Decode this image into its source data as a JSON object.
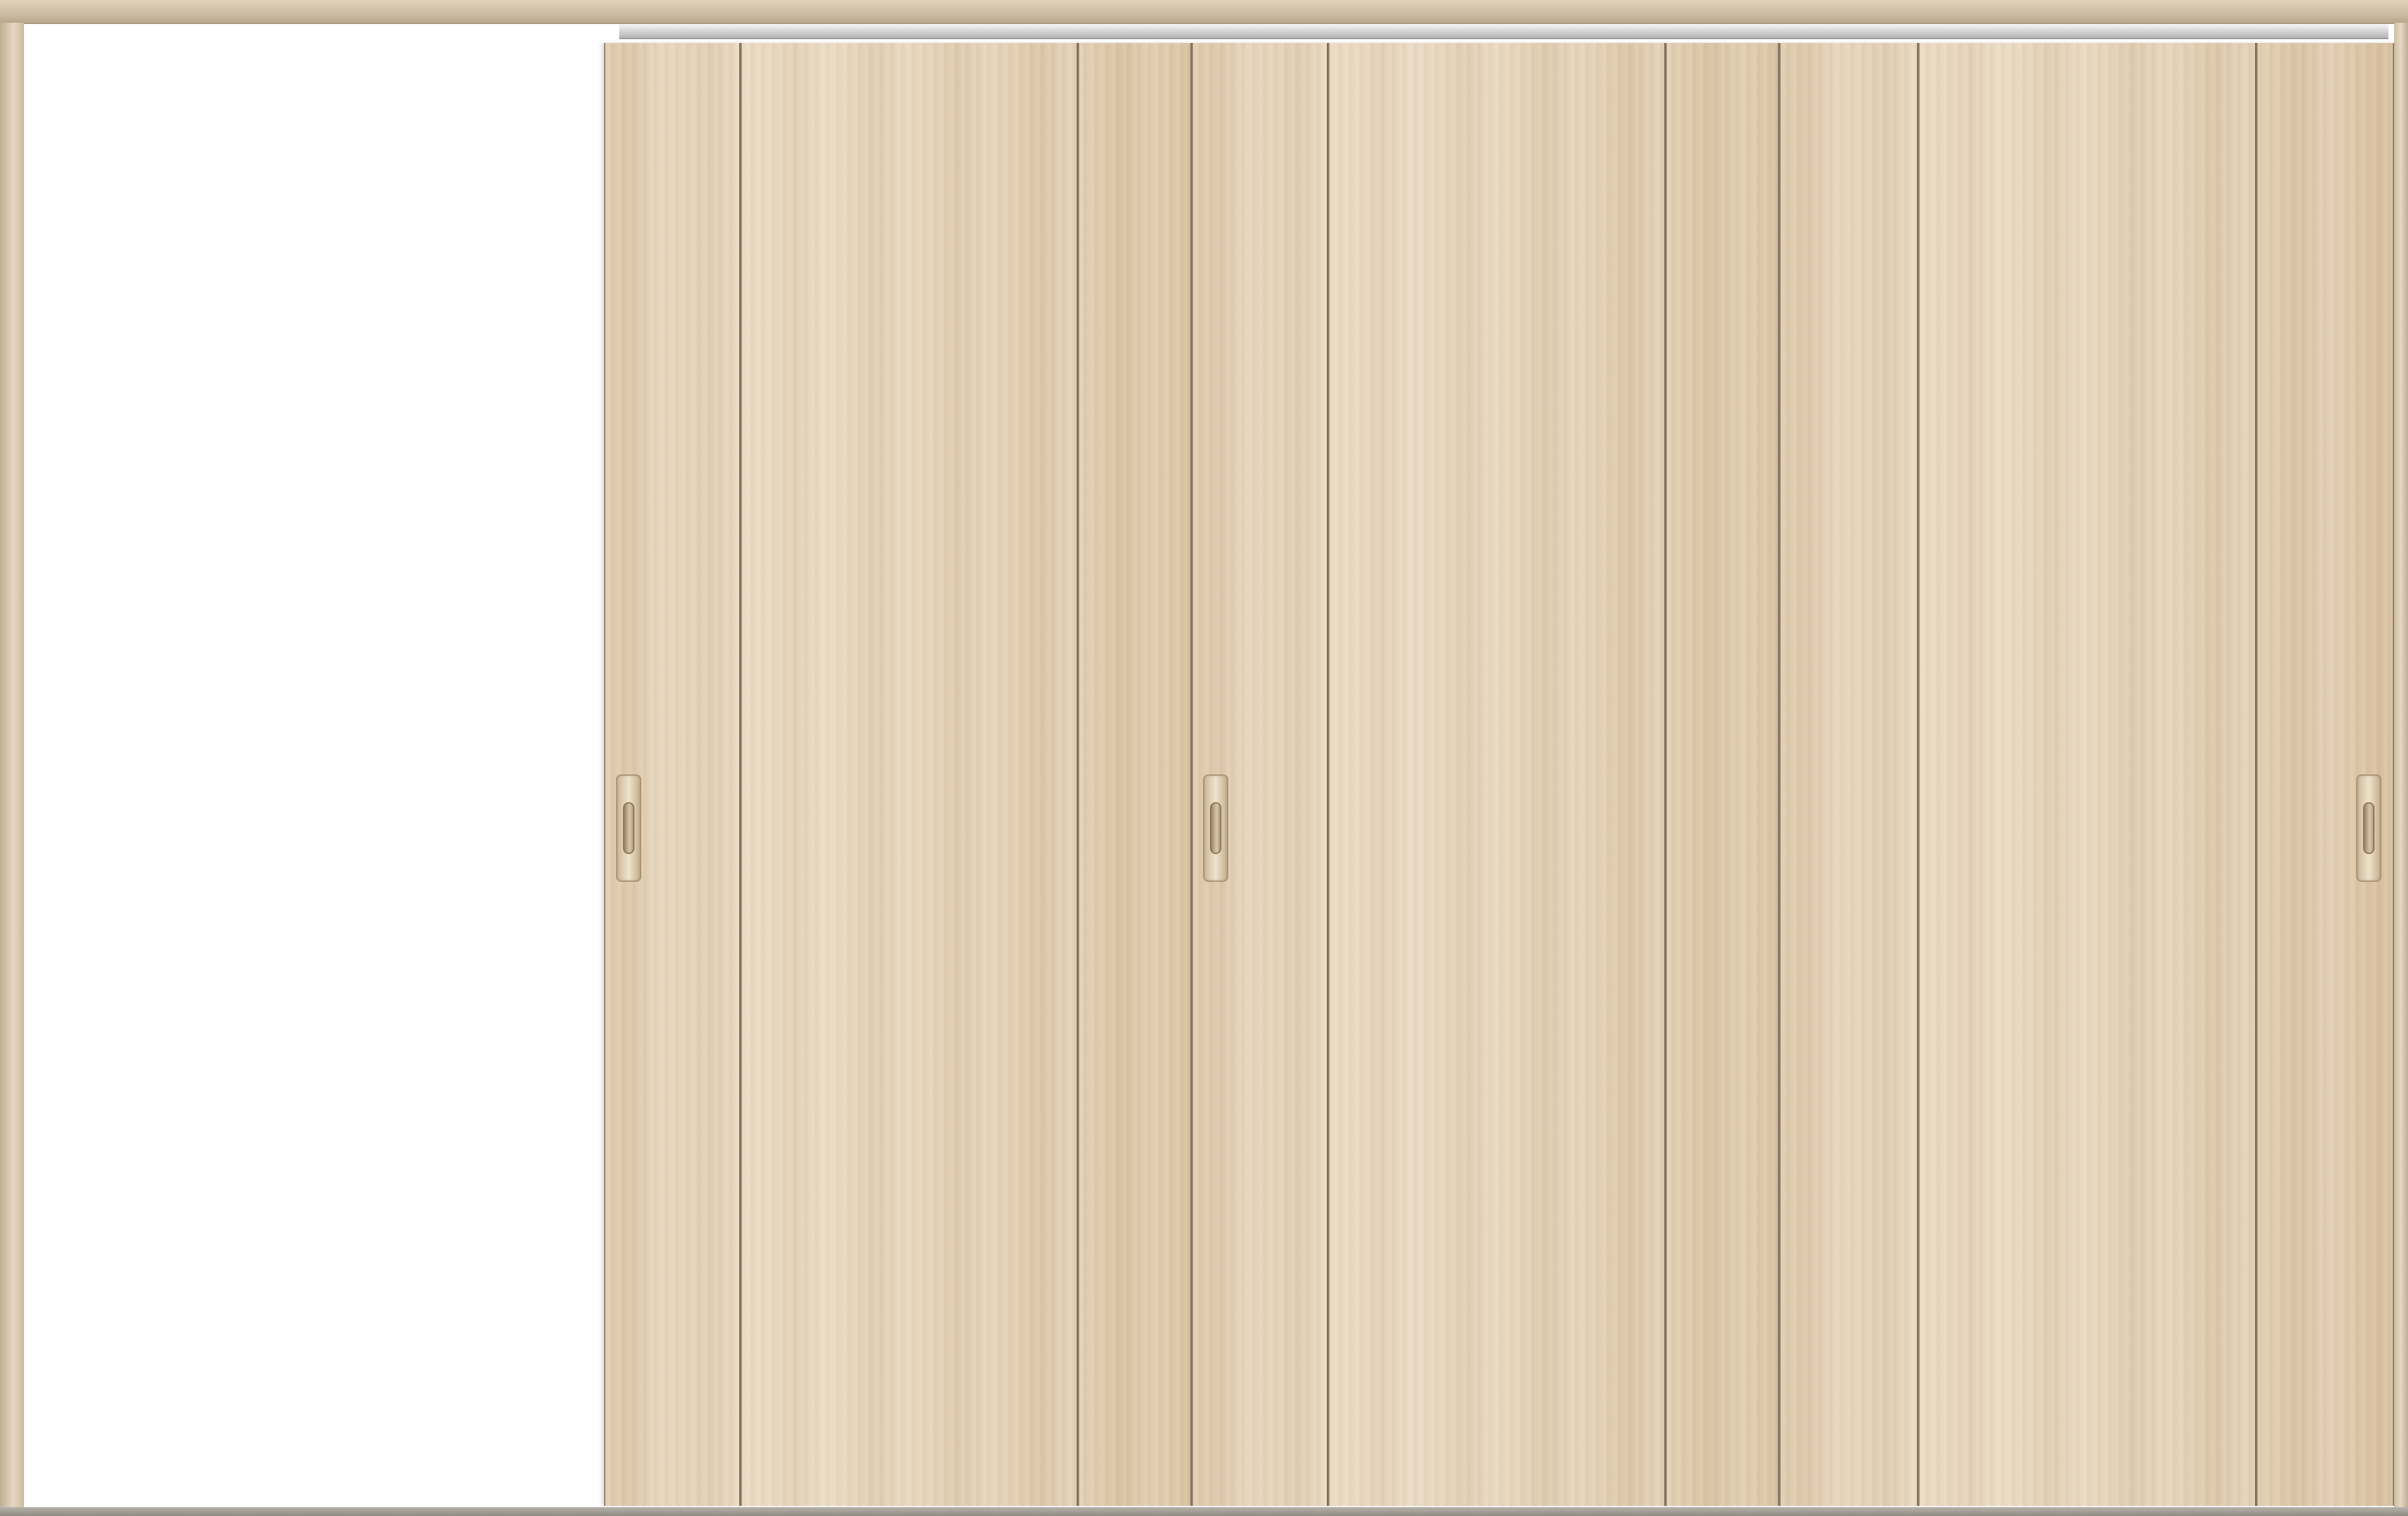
{
  "scene": {
    "subject": "sliding-door-set",
    "panel_count": 3,
    "colors": {
      "wood_light": "#ebdac2",
      "wood_mid": "#e2cdb0",
      "wood_dark": "#ddc6a6",
      "frame": "#cdbca2",
      "rail": "#cfcfcf",
      "groove": "#6f5f4b",
      "opening": "#ffffff"
    },
    "icons": [
      "door-handle-icon"
    ]
  }
}
